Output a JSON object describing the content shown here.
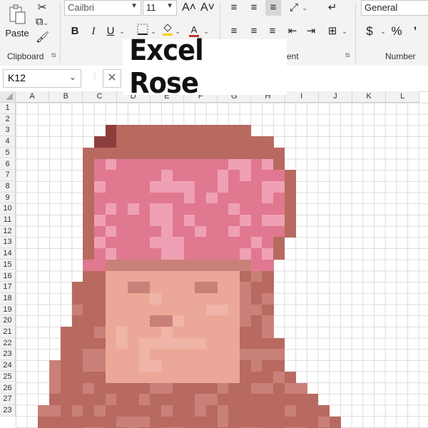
{
  "ribbon": {
    "clipboard": {
      "paste_label": "Paste",
      "group_label": "Clipboard"
    },
    "font": {
      "font_name": "Cailbri",
      "font_size": "11",
      "grow_label": "A˄",
      "shrink_label": "A˅",
      "bold": "B",
      "italic": "I",
      "underline": "U",
      "font_color_label": "A"
    },
    "alignment": {
      "group_label": "ent"
    },
    "number": {
      "format": "General",
      "currency": "$",
      "percent": "%",
      "comma": "’",
      "group_label": "Number"
    }
  },
  "title_overlay": "Excel Rose",
  "formula_bar": {
    "name_box": "K12",
    "cancel": "✕"
  },
  "columns": [
    "A",
    "B",
    "C",
    "D",
    "E",
    "F",
    "G",
    "H",
    "I",
    "J",
    "K",
    "L"
  ],
  "rows": [
    "1",
    "2",
    "3",
    "4",
    "5",
    "6",
    "7",
    "8",
    "9",
    "10",
    "11",
    "12",
    "13",
    "14",
    "15",
    "16",
    "17",
    "18",
    "19",
    "20",
    "21",
    "22",
    "23",
    "24",
    "25",
    "26",
    "27",
    "23"
  ],
  "colors": {
    "grid_line": "#dcdcdc",
    "hat_pink": "#e07890",
    "hat_light": "#f0a0b4",
    "hair": "#b86a60",
    "hair_dark": "#8c3e3c",
    "face": "#eba898",
    "face_shadow": "#c98078",
    "cheek": "#f0b4a8",
    "white": "#ffffff"
  }
}
